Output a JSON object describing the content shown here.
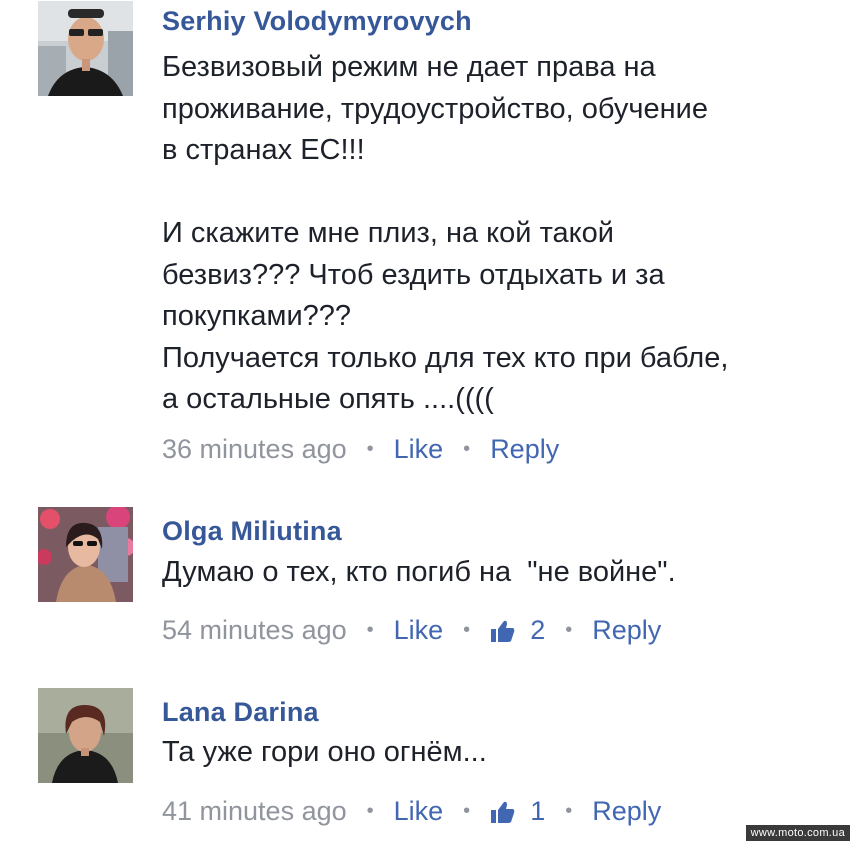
{
  "comments": [
    {
      "author": "Serhiy Volodymyrovych",
      "text": "Безвизовый режим не дает права на\nпроживание, трудоустройство, обучение\nв странах ЕС!!!\n\nИ скажите мне плиз, на кой такой\nбезвиз??? Чтоб ездить отдыхать и за\nпокупками???\nПолучается только для тех кто при бабле,\nа остальные опять ....((((",
      "time": "36 minutes ago",
      "like_label": "Like",
      "reply_label": "Reply",
      "avatar_icon": "user-photo-man-sunglasses"
    },
    {
      "author": "Olga Miliutina",
      "text": "Думаю о тех, кто погиб на  \"не войне\".",
      "time": "54 minutes ago",
      "like_label": "Like",
      "likes_count": "2",
      "reply_label": "Reply",
      "avatar_icon": "user-photo-woman-flowers"
    },
    {
      "author": "Lana Darina",
      "text": "Та уже гори оно огнём...",
      "time": "41 minutes ago",
      "like_label": "Like",
      "likes_count": "1",
      "reply_label": "Reply",
      "avatar_icon": "user-photo-woman"
    }
  ],
  "watermark": "www.moto.com.ua",
  "colors": {
    "author": "#365899",
    "link": "#4267b2",
    "meta": "#90949c",
    "text": "#1d2129"
  }
}
